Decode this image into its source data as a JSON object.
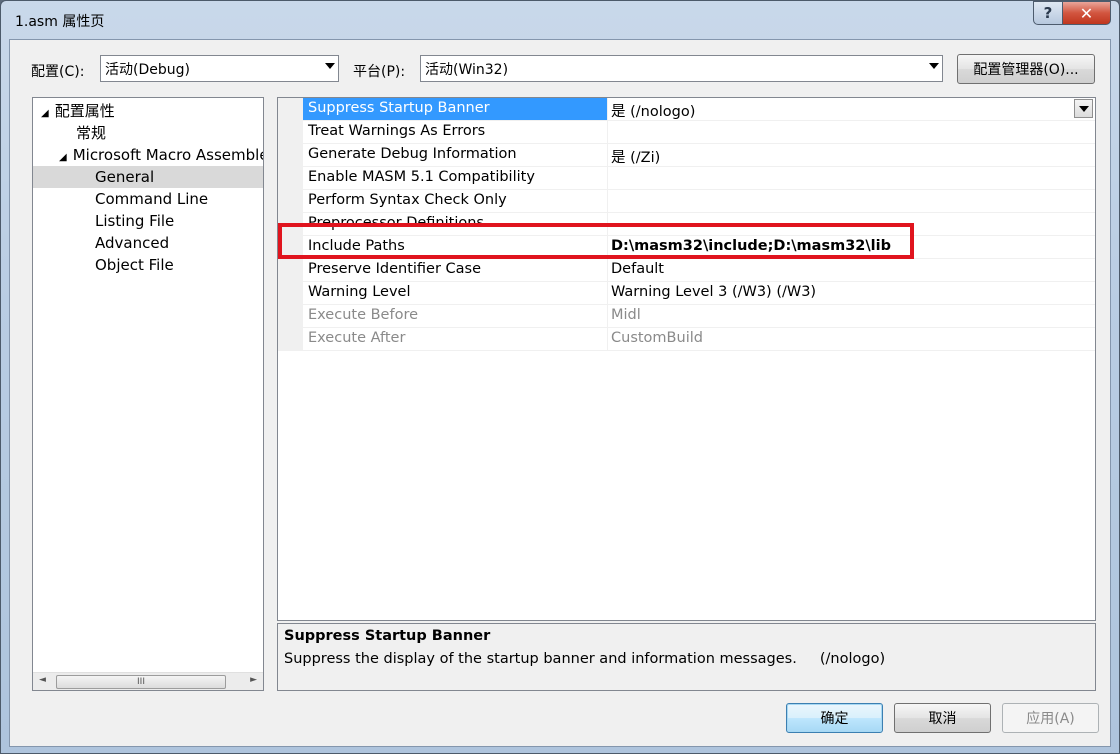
{
  "window": {
    "title": "1.asm 属性页",
    "help_glyph": "?",
    "close_glyph": "✕"
  },
  "toolbar": {
    "config_label": "配置(C):",
    "config_value": "活动(Debug)",
    "platform_label": "平台(P):",
    "platform_value": "活动(Win32)",
    "config_manager_label": "配置管理器(O)..."
  },
  "tree": {
    "items": [
      {
        "label": "配置属性",
        "expanded": true
      },
      {
        "label": "常规"
      },
      {
        "label": "Microsoft Macro Assembler",
        "expanded": true
      },
      {
        "label": "General",
        "selected": true
      },
      {
        "label": "Command Line"
      },
      {
        "label": "Listing File"
      },
      {
        "label": "Advanced"
      },
      {
        "label": "Object File"
      }
    ],
    "scroll_grip": "III",
    "scroll_left": "◄",
    "scroll_right": "►"
  },
  "properties": [
    {
      "name": "Suppress Startup Banner",
      "value": "是 (/nologo)",
      "selected": true
    },
    {
      "name": "Treat Warnings As Errors",
      "value": ""
    },
    {
      "name": "Generate Debug Information",
      "value": "是 (/Zi)"
    },
    {
      "name": "Enable MASM 5.1 Compatibility",
      "value": ""
    },
    {
      "name": "Perform Syntax Check Only",
      "value": ""
    },
    {
      "name": "Preprocessor Definitions",
      "value": ""
    },
    {
      "name": "Include Paths",
      "value": "D:\\masm32\\include;D:\\masm32\\lib",
      "bold": true
    },
    {
      "name": "Preserve Identifier Case",
      "value": "Default"
    },
    {
      "name": "Warning Level",
      "value": "Warning Level 3 (/W3) (/W3)"
    },
    {
      "name": "Execute Before",
      "value": "Midl",
      "disabled": true
    },
    {
      "name": "Execute After",
      "value": "CustomBuild",
      "disabled": true
    }
  ],
  "description": {
    "title": "Suppress Startup Banner",
    "text": "Suppress the display of the startup banner and information messages.     (/nologo)"
  },
  "buttons": {
    "ok": "确定",
    "cancel": "取消",
    "apply": "应用(A)"
  },
  "colors": {
    "selection": "#3399ff",
    "highlight_box": "#e0141e"
  }
}
